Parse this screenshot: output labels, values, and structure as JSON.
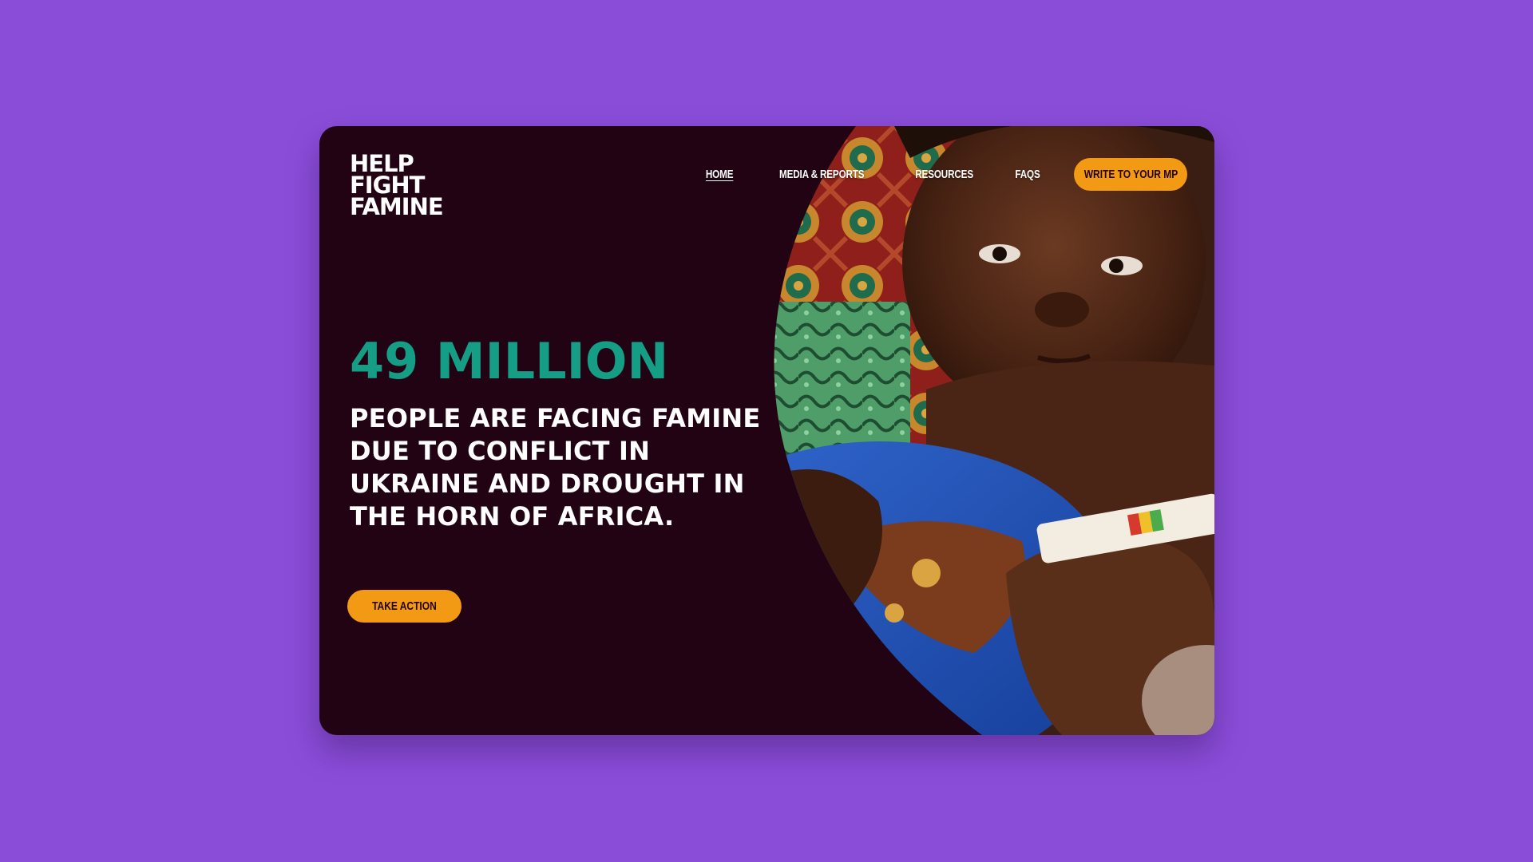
{
  "colors": {
    "page_background": "#8a4dd8",
    "card_background": "#220313",
    "accent_orange": "#f39a15",
    "accent_teal": "#159d86",
    "text_white": "#ffffff"
  },
  "brand": {
    "line1": "HELP",
    "line2": "FIGHT",
    "line3": "FAMINE"
  },
  "nav": {
    "items": [
      {
        "label": "HOME",
        "active": true
      },
      {
        "label": "MEDIA & REPORTS",
        "active": false
      },
      {
        "label": "RESOURCES",
        "active": false
      },
      {
        "label": "FAQS",
        "active": false
      }
    ],
    "cta_label": "WRITE TO YOUR MP"
  },
  "hero": {
    "stat": "49 MILLION",
    "statement": "PEOPLE ARE FACING FAMINE DUE TO CONFLICT IN UKRAINE AND DROUGHT IN THE HORN OF AFRICA.",
    "cta_label": "TAKE ACTION",
    "image_subject": "child-being-measured-with-muac-band"
  }
}
